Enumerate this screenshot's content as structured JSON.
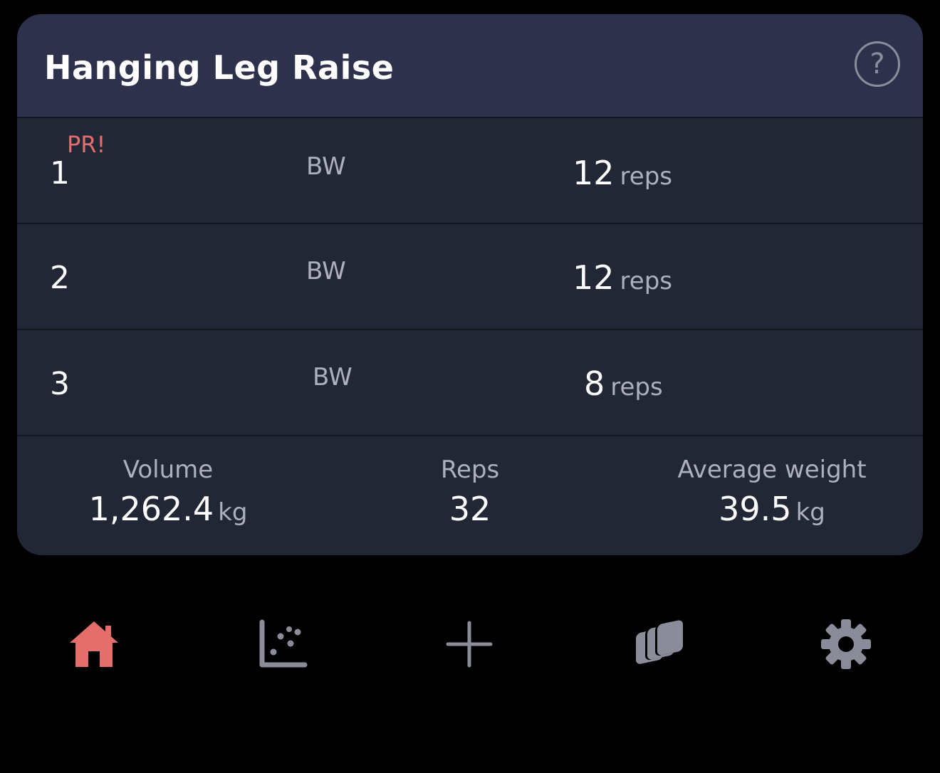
{
  "card": {
    "title": "Hanging Leg Raise",
    "help_icon": "question-circle-icon",
    "help_symbol": "?"
  },
  "sets": [
    {
      "number": "1",
      "badge": "PR!",
      "weight": "BW",
      "reps": "12",
      "reps_unit": "reps"
    },
    {
      "number": "2",
      "badge": "",
      "weight": "BW",
      "reps": "12",
      "reps_unit": "reps"
    },
    {
      "number": "3",
      "badge": "",
      "weight": "BW",
      "reps": "8",
      "reps_unit": "reps"
    }
  ],
  "summary": {
    "volume": {
      "label": "Volume",
      "value": "1,262.4",
      "unit": "kg"
    },
    "reps": {
      "label": "Reps",
      "value": "32"
    },
    "average_weight": {
      "label": "Average weight",
      "value": "39.5",
      "unit": "kg"
    }
  },
  "nav": {
    "items": [
      {
        "icon": "home-icon",
        "active": true
      },
      {
        "icon": "scatter-chart-icon",
        "active": false
      },
      {
        "icon": "plus-icon",
        "active": false
      },
      {
        "icon": "stacked-cards-icon",
        "active": false
      },
      {
        "icon": "gear-icon",
        "active": false
      }
    ],
    "active_color": "#e46e6b",
    "inactive_color": "#8a8d99"
  },
  "colors": {
    "background": "#000000",
    "card": "#222736",
    "header": "#2d314b",
    "pr_accent": "#e46e6b"
  }
}
